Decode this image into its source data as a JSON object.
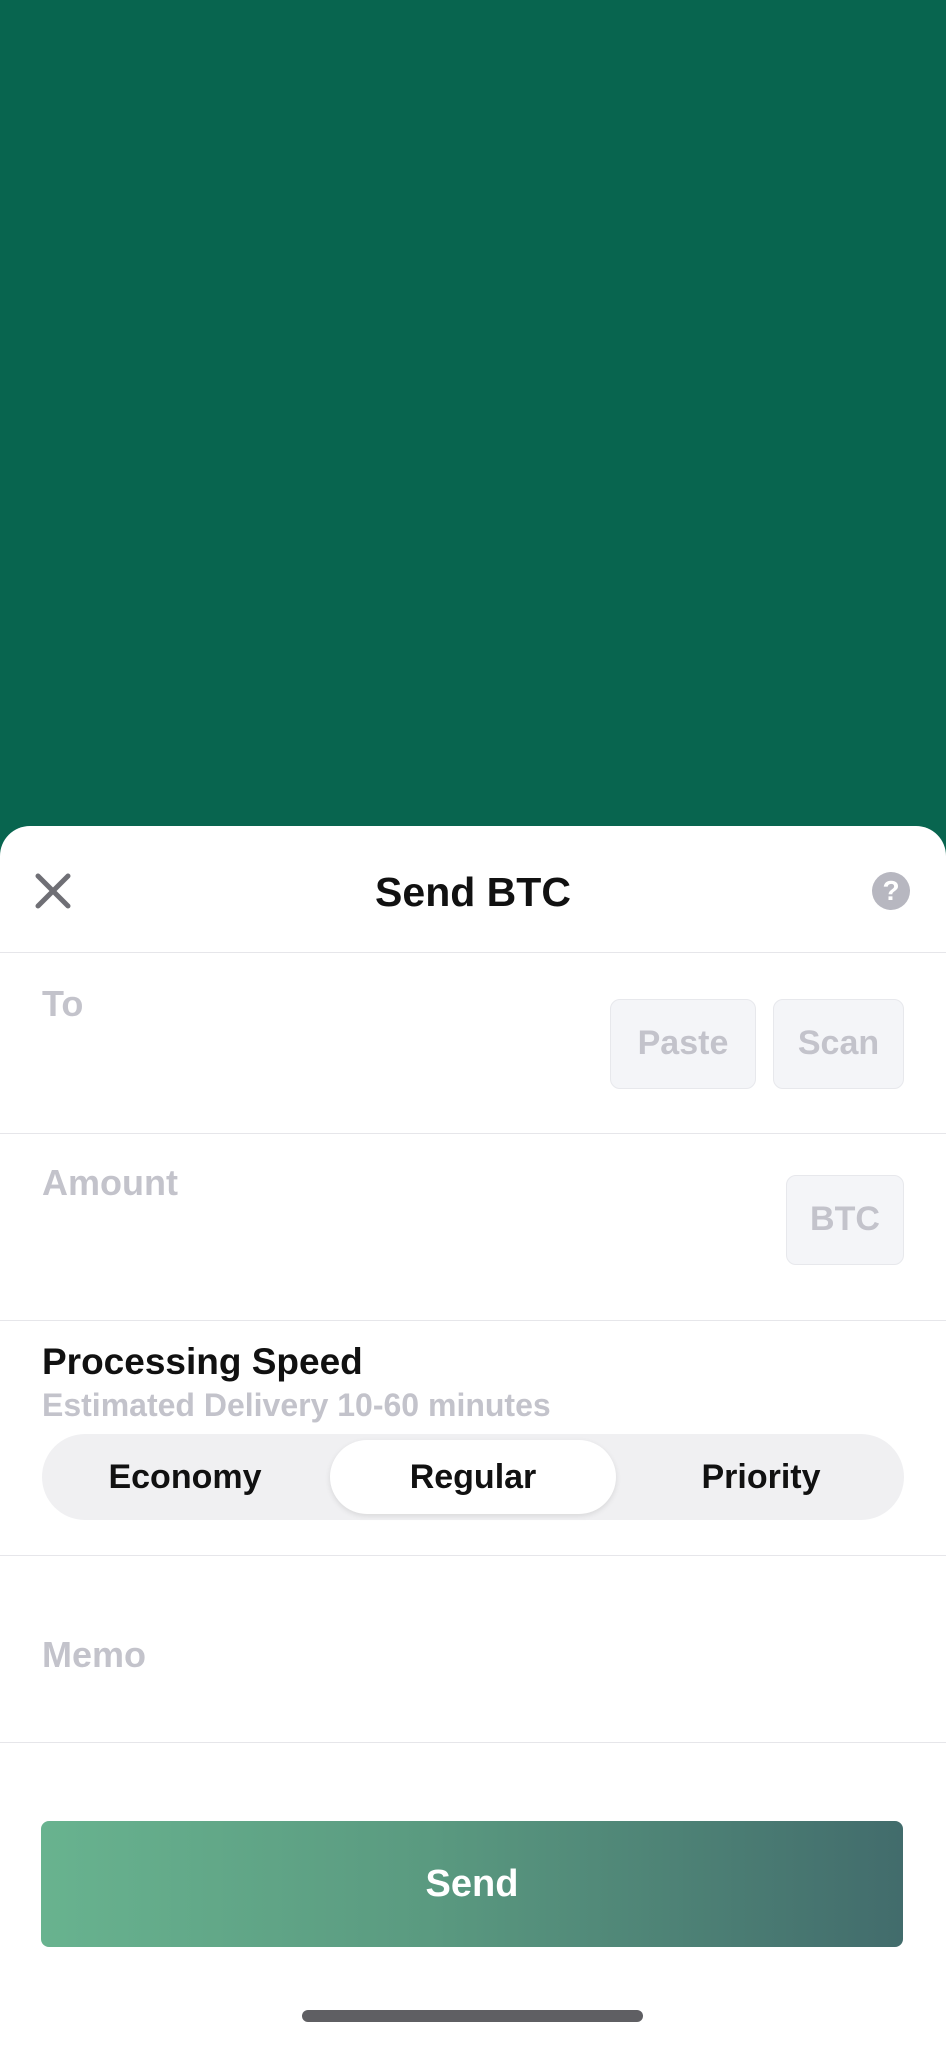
{
  "theme": {
    "background": "#08654f",
    "send_gradient": [
      "#68b38f",
      "#426c6c"
    ]
  },
  "header": {
    "title": "Send BTC",
    "close_icon": "close-icon",
    "help_label": "?"
  },
  "to_field": {
    "label": "To",
    "paste_label": "Paste",
    "scan_label": "Scan"
  },
  "amount_field": {
    "label": "Amount",
    "currency_label": "BTC"
  },
  "speed": {
    "title": "Processing Speed",
    "subtitle": "Estimated Delivery 10-60 minutes",
    "options": [
      "Economy",
      "Regular",
      "Priority"
    ],
    "selected": "Regular"
  },
  "memo_field": {
    "label": "Memo"
  },
  "send_button": {
    "label": "Send"
  }
}
